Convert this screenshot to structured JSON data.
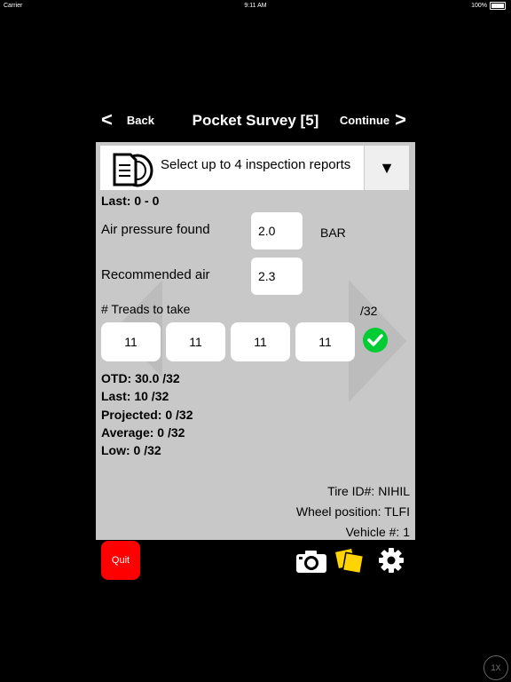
{
  "status_bar": {
    "carrier": "Carrier",
    "time": "9:11 AM",
    "battery": "100%"
  },
  "nav": {
    "back_label": "Back",
    "title": "Pocket Survey [5]",
    "continue_label": "Continue"
  },
  "dropdown": {
    "text": "Select up to 4 inspection reports",
    "icon": "tire-report-icon"
  },
  "last_range": "Last: 0 - 0",
  "air_pressure": {
    "label": "Air pressure found",
    "value": "2.0",
    "unit": "BAR"
  },
  "recommended_air": {
    "label": "Recommended air",
    "value": "2.3"
  },
  "treads": {
    "label": "# Treads to take",
    "unit": "/32",
    "values": [
      "11",
      "11",
      "11",
      "11"
    ]
  },
  "stats": {
    "otd": "OTD: 30.0 /32",
    "last": "Last: 10 /32",
    "projected": "Projected: 0 /32",
    "average": "Average: 0 /32",
    "low": "Low: 0 /32"
  },
  "info": {
    "tire_id": "Tire ID#: NIHIL",
    "wheel_position": "Wheel position: TLFI",
    "vehicle": "Vehicle #: 1"
  },
  "toolbar": {
    "quit_label": "Quit",
    "zoom_label": "1X"
  },
  "colors": {
    "quit": "#ff0000",
    "check": "#00cc33",
    "panel": "#c8c8c8",
    "notes": "#ffd400"
  }
}
